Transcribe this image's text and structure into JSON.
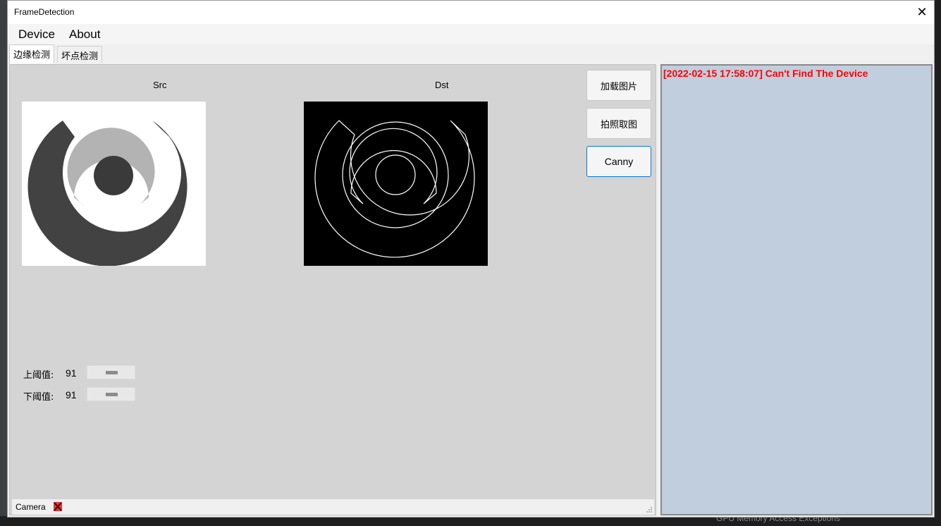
{
  "window": {
    "title": "FrameDetection",
    "close_glyph": "✕"
  },
  "menu": {
    "items": [
      "Device",
      "About"
    ]
  },
  "tabs": [
    {
      "label": "边缘检测",
      "active": true
    },
    {
      "label": "坏点检测",
      "active": false
    }
  ],
  "images": {
    "src_label": "Src",
    "dst_label": "Dst"
  },
  "buttons": {
    "load_image": "加载图片",
    "capture": "拍照取图",
    "canny": "Canny"
  },
  "params": {
    "upper_label": "上阈值:",
    "upper_value": "91",
    "lower_label": "下阈值:",
    "lower_value": "91"
  },
  "status": {
    "camera_label": "Camera",
    "camera_icon": "camera-disconnected-icon"
  },
  "log": {
    "lines": [
      "[2022-02-15 17:58:07] Can't Find The Device"
    ],
    "color": "#ff0000"
  },
  "background": {
    "bottom_text": "GPU Memory Access Exceptions"
  }
}
